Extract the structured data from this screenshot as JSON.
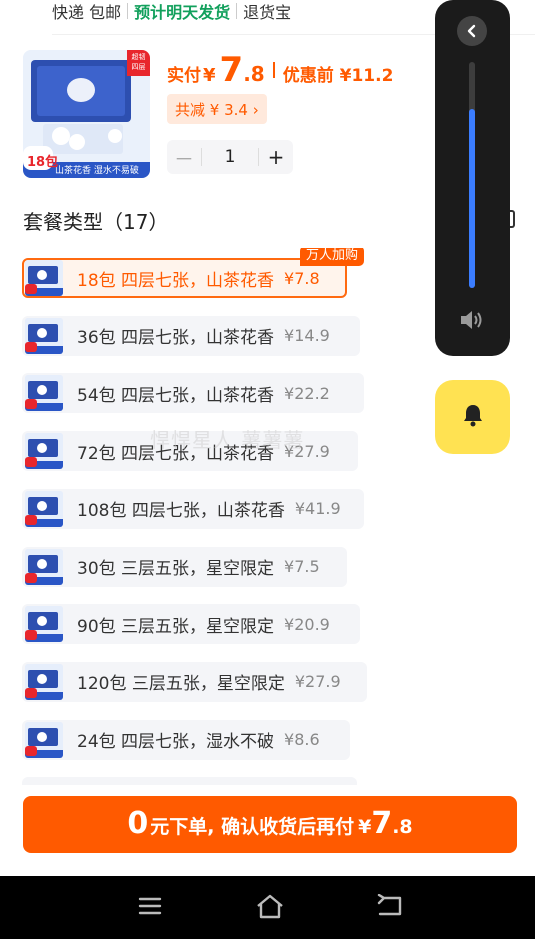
{
  "shipping": {
    "free": "快递 包邮",
    "ship_time": "预计明天发货",
    "returns": "退货宝"
  },
  "product": {
    "pay_label": "实付",
    "currency": "¥",
    "price_int": "7",
    "price_dec": ".8",
    "orig_label": "优惠前 ¥11.2",
    "discount": "共减 ¥ 3.4 ›",
    "quantity": "1",
    "minus": "－",
    "plus": "+",
    "thumb_pack_label": "18包",
    "thumb_caption": "山茶花香 湿水不易破",
    "thumb_badge": "超韧 四层"
  },
  "package_section": {
    "title": "套餐类型（17）"
  },
  "options": [
    {
      "name": "18包 四层七张，山茶花香",
      "price": "¥7.8",
      "selected": true,
      "badge": "万人加购"
    },
    {
      "name": "36包  四层七张，山茶花香",
      "price": "¥14.9",
      "selected": false
    },
    {
      "name": "54包  四层七张，山茶花香",
      "price": "¥22.2",
      "selected": false
    },
    {
      "name": "72包 四层七张，山茶花香",
      "price": "¥27.9",
      "selected": false
    },
    {
      "name": "108包 四层七张，山茶花香",
      "price": "¥41.9",
      "selected": false
    },
    {
      "name": "30包 三层五张，星空限定",
      "price": "¥7.5",
      "selected": false
    },
    {
      "name": "90包 三层五张，星空限定",
      "price": "¥20.9",
      "selected": false
    },
    {
      "name": "120包 三层五张，星空限定",
      "price": "¥27.9",
      "selected": false
    },
    {
      "name": "24包 四层七张，湿水不破",
      "price": "¥8.6",
      "selected": false
    }
  ],
  "volume_overlay": {
    "level_fraction": 0.79,
    "back_icon": "chevron-left-icon",
    "speaker_icon": "speaker-icon",
    "bell_icon": "bell-icon",
    "track_color": "#3d3d3d",
    "fill_color": "#3b7dff",
    "bell_bg": "#ffe252"
  },
  "cta": {
    "zero": "0",
    "text": "元下单, 确认收货后再付",
    "currency": "¥",
    "price_int": "7",
    "price_dec": ".8"
  },
  "system_nav": {
    "menu_icon": "menu-icon",
    "home_icon": "home-icon",
    "back_icon": "back-icon"
  },
  "colors": {
    "accent": "#ff5a00",
    "green": "#12a05c"
  }
}
